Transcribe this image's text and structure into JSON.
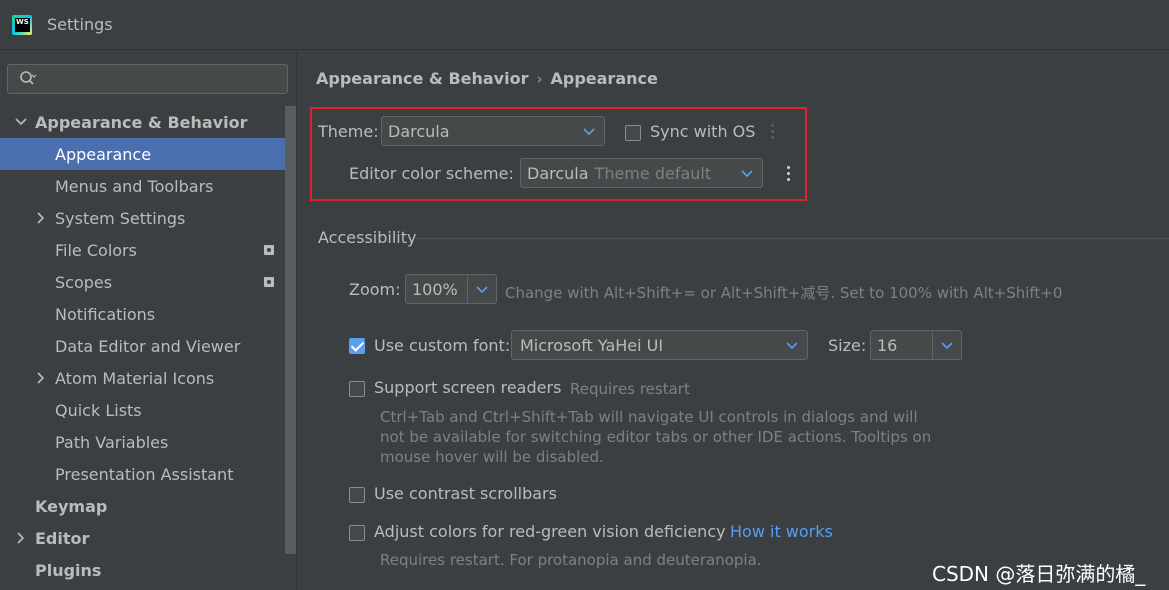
{
  "window": {
    "title": "Settings",
    "app_icon": "webstorm-logo-icon"
  },
  "search": {
    "placeholder": ""
  },
  "sidebar": {
    "items": [
      {
        "label": "Appearance & Behavior",
        "expanded": true
      },
      {
        "label": "Appearance",
        "selected": true
      },
      {
        "label": "Menus and Toolbars"
      },
      {
        "label": "System Settings"
      },
      {
        "label": "File Colors"
      },
      {
        "label": "Scopes"
      },
      {
        "label": "Notifications"
      },
      {
        "label": "Data Editor and Viewer"
      },
      {
        "label": "Atom Material Icons"
      },
      {
        "label": "Quick Lists"
      },
      {
        "label": "Path Variables"
      },
      {
        "label": "Presentation Assistant"
      },
      {
        "label": "Keymap"
      },
      {
        "label": "Editor"
      },
      {
        "label": "Plugins"
      }
    ]
  },
  "breadcrumb": {
    "parent": "Appearance & Behavior",
    "separator": "›",
    "current": "Appearance"
  },
  "theme": {
    "label": "Theme:",
    "value": "Darcula",
    "sync_label": "Sync with OS",
    "sync_checked": false
  },
  "editor_scheme": {
    "label": "Editor color scheme:",
    "value": "Darcula",
    "value_hint": "Theme default"
  },
  "accessibility": {
    "title": "Accessibility",
    "zoom_label": "Zoom:",
    "zoom_value": "100%",
    "zoom_hint": "Change with Alt+Shift+= or Alt+Shift+减号. Set to 100% with Alt+Shift+0",
    "custom_font_label": "Use custom font:",
    "custom_font_checked": true,
    "font_value": "Microsoft YaHei UI",
    "size_label": "Size:",
    "size_value": "16",
    "screen_readers_label": "Support screen readers",
    "screen_readers_hint": "Requires restart",
    "screen_readers_desc": "Ctrl+Tab and Ctrl+Shift+Tab will navigate UI controls in dialogs and will not be available for switching editor tabs or other IDE actions. Tooltips on mouse hover will be disabled.",
    "contrast_label": "Use contrast scrollbars",
    "colorblind_label": "Adjust colors for red-green vision deficiency",
    "colorblind_link": "How it works",
    "colorblind_desc": "Requires restart. For protanopia and deuteranopia."
  },
  "watermark": "CSDN @落日弥满的橘_",
  "colors": {
    "background": "#3c3f41",
    "selection": "#4b6eaf",
    "highlight_border": "#e0202a",
    "link": "#589df6"
  }
}
